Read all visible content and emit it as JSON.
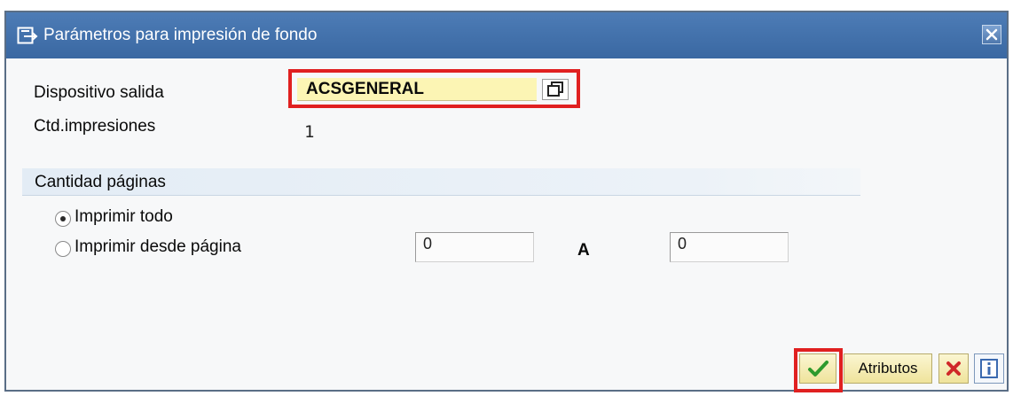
{
  "window": {
    "title": "Parámetros para impresión de fondo",
    "title_icon": "print-parameters-icon",
    "close_icon": "close-icon"
  },
  "fields": {
    "output_device": {
      "label": "Dispositivo salida",
      "value": "ACSGENERAL",
      "help_icon": "value-help-icon"
    },
    "num_copies": {
      "label": "Ctd.impresiones",
      "value": "1"
    }
  },
  "pages_group": {
    "title": "Cantidad páginas",
    "options": [
      {
        "label": "Imprimir todo",
        "selected": true
      },
      {
        "label": "Imprimir desde página",
        "selected": false
      }
    ],
    "from_value": "0",
    "to_label": "A",
    "to_value": "0"
  },
  "buttons": {
    "ok_icon": "checkmark-icon",
    "attributes_label": "Atributos",
    "cancel_icon": "cancel-x-icon",
    "info_icon": "info-icon"
  },
  "colors": {
    "titlebar": "#3f6ea9",
    "highlight": "#e02020",
    "input_yellow": "#fcf5b4",
    "button_gradient": "#efe39b"
  }
}
